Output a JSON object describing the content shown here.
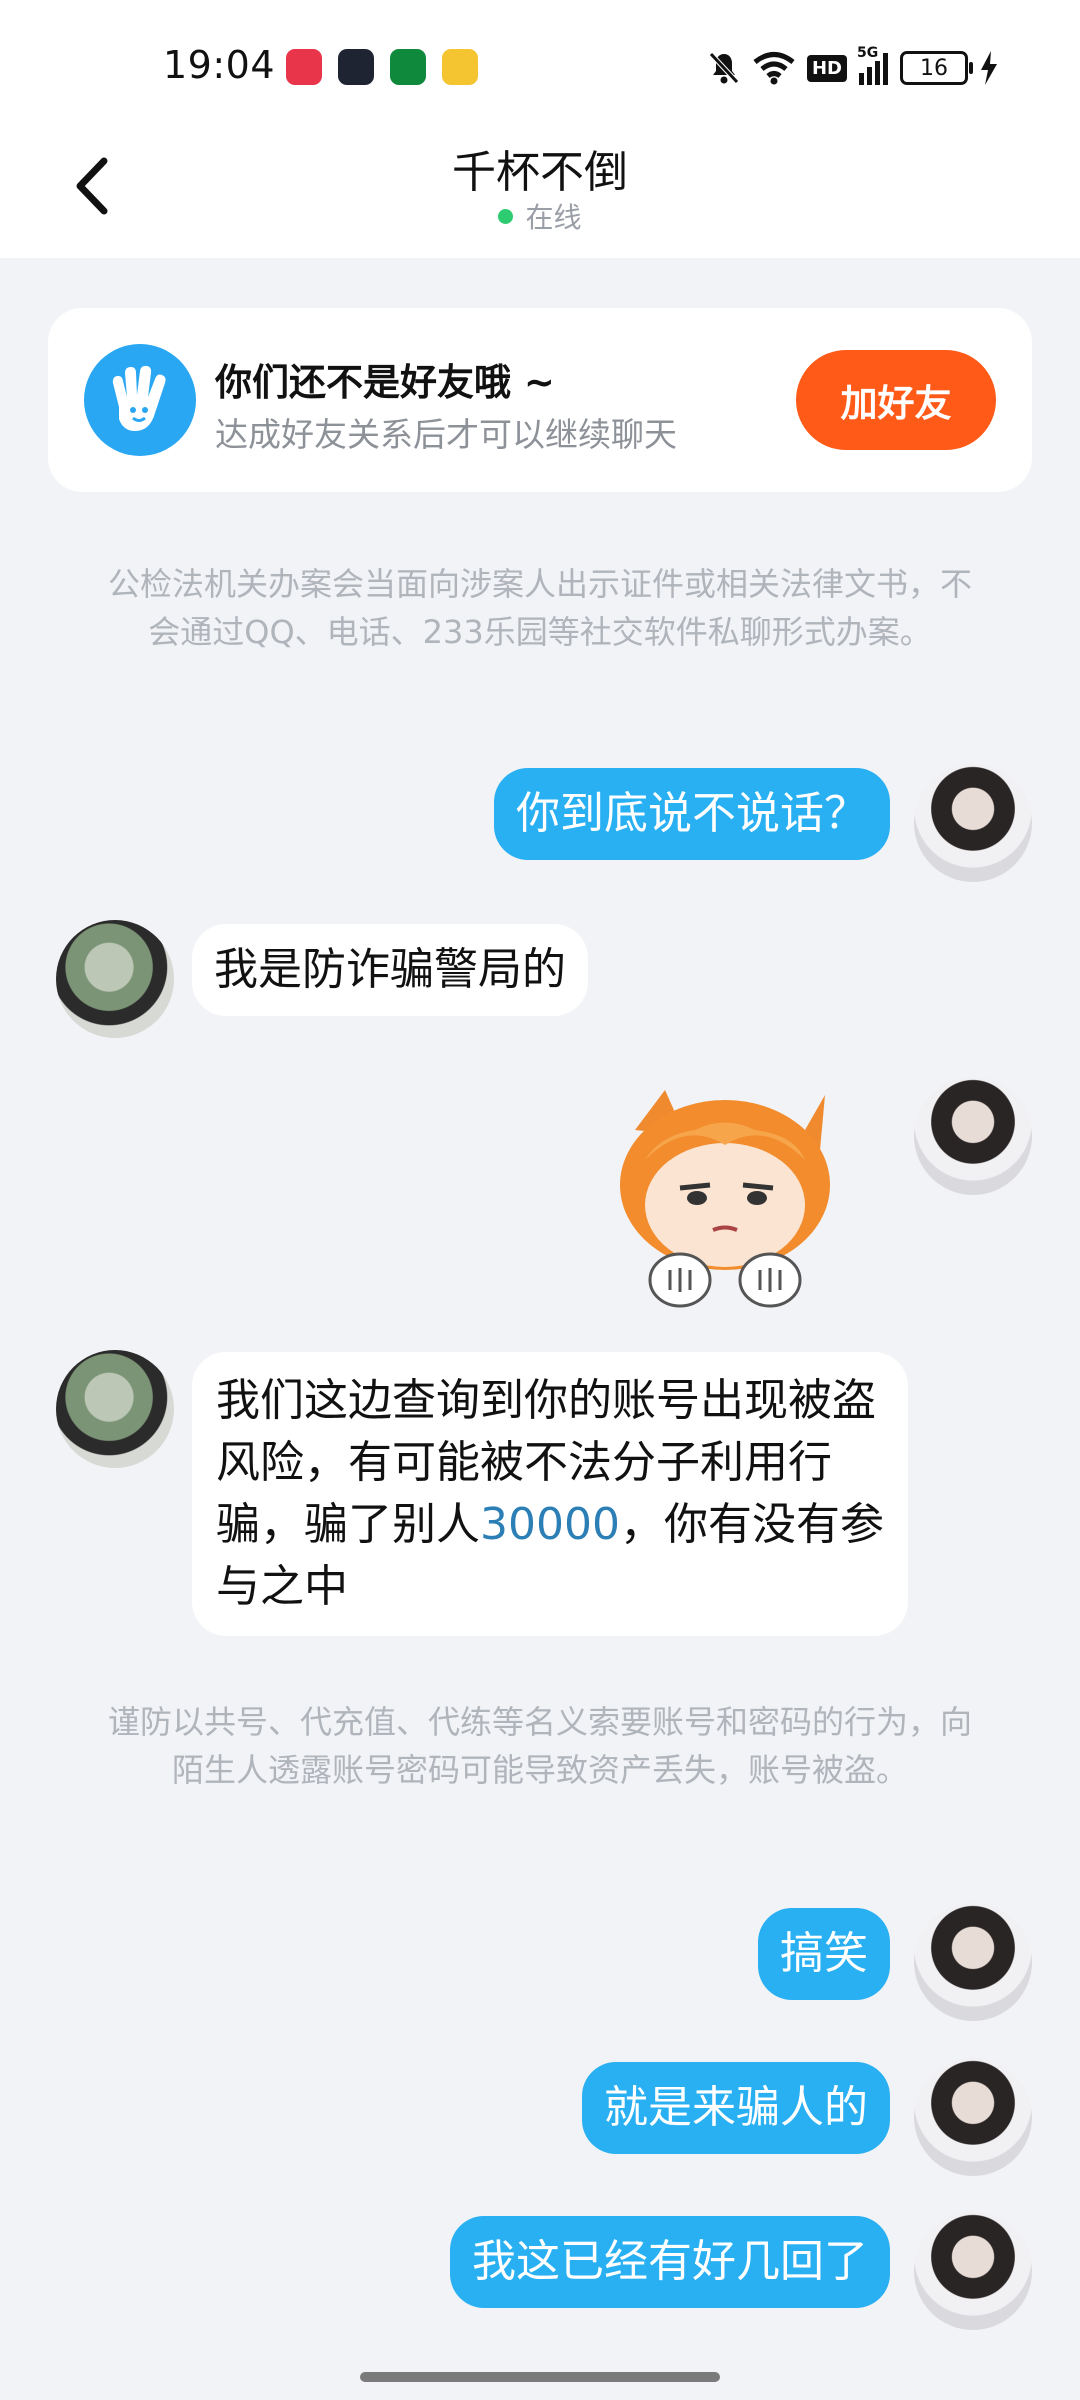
{
  "status_bar": {
    "time": "19:04",
    "network": "5G",
    "hd": "HD",
    "battery": "16",
    "app_icon_colors": [
      "#e8354a",
      "#1f2433",
      "#0f8a3c",
      "#f5c431"
    ]
  },
  "header": {
    "title": "千杯不倒",
    "status": "在线"
  },
  "friend_card": {
    "title": "你们还不是好友哦 ~",
    "subtitle": "达成好友关系后才可以继续聊天",
    "button": "加好友"
  },
  "notices": [
    "公检法机关办案会当面向涉案人出示证件或相关法律文书，不会通过QQ、电话、233乐园等社交软件私聊形式办案。",
    "谨防以共号、代充值、代练等名义索要账号和密码的行为，向陌生人透露账号密码可能导致资产丢失，账号被盗。"
  ],
  "messages": [
    {
      "from": "me",
      "text": "你到底说不说话？"
    },
    {
      "from": "other",
      "text": "我是防诈骗警局的"
    },
    {
      "from": "me",
      "type": "sticker"
    },
    {
      "from": "other",
      "text_pre": "我们这边查询到你的账号出现被盗风险，有可能被不法分子利用行骗，骗了别人",
      "text_num": "30000",
      "text_post": "，你有没有参与之中"
    },
    {
      "from": "me",
      "text": "搞笑"
    },
    {
      "from": "me",
      "text": "就是来骗人的"
    },
    {
      "from": "me",
      "text": "我这已经有好几回了"
    }
  ],
  "colors": {
    "accent_blue": "#29b0f3",
    "add_button": "#ff5a18",
    "online_dot": "#2ecc71",
    "number_link": "#2c7fb5"
  }
}
